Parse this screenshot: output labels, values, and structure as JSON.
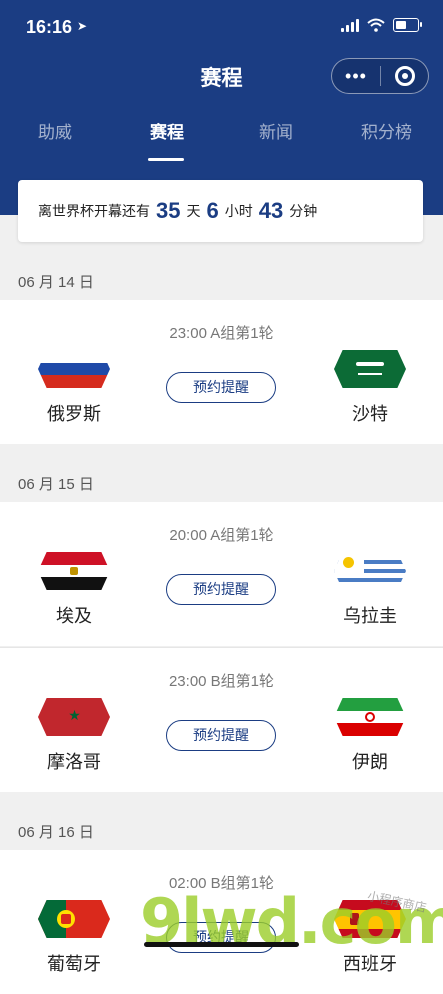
{
  "status_bar": {
    "time": "16:16",
    "location_glyph": "➤"
  },
  "nav": {
    "title": "赛程",
    "more_glyph": "•••"
  },
  "tabs": [
    {
      "label": "助威"
    },
    {
      "label": "赛程",
      "active": true
    },
    {
      "label": "新闻"
    },
    {
      "label": "积分榜"
    }
  ],
  "countdown": {
    "prefix": "离世界杯开幕还有",
    "days": "35",
    "days_unit": "天",
    "hours": "6",
    "hours_unit": "小时",
    "minutes": "43",
    "minutes_unit": "分钟"
  },
  "dates": [
    "06 月 14 日",
    "06 月 15 日",
    "06 月 16 日"
  ],
  "matches": [
    {
      "info": "23:00 A组第1轮",
      "home": "俄罗斯",
      "away": "沙特",
      "button": "预约提醒"
    },
    {
      "info": "20:00 A组第1轮",
      "home": "埃及",
      "away": "乌拉圭",
      "button": "预约提醒"
    },
    {
      "info": "23:00 B组第1轮",
      "home": "摩洛哥",
      "away": "伊朗",
      "button": "预约提醒"
    },
    {
      "info": "02:00 B组第1轮",
      "home": "葡萄牙",
      "away": "西班牙",
      "button": "预约提醒"
    }
  ],
  "watermark": {
    "big": "9lwd.com",
    "small": "小程序商店"
  },
  "colors": {
    "brand": "#1b3d83",
    "background": "#f0f0f0"
  }
}
